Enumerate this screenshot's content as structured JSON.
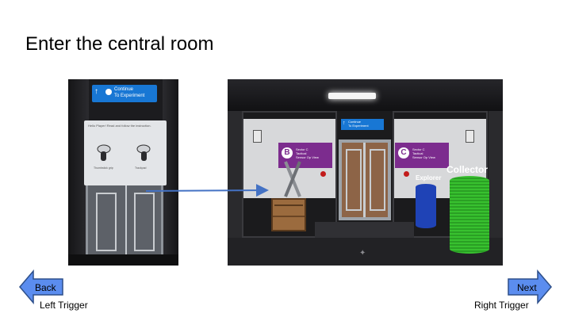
{
  "slide": {
    "title": "Enter the central room"
  },
  "left_screenshot": {
    "banner": {
      "arrow": "↑",
      "line1": "Continue",
      "line2": "To Experiment"
    },
    "instructions": {
      "heading": "Hello Player! Read and follow the instruction.",
      "left_controller_label": "Thumbstick grip",
      "right_controller_label": "Trackpad"
    }
  },
  "right_screenshot": {
    "banner": {
      "arrow": "↑",
      "line1": "Continue",
      "line2": "To Experiment"
    },
    "sign_left": {
      "letter": "B",
      "line1": "Sector C",
      "line2": "Tactical",
      "line3": "Sensor Op View"
    },
    "sign_right": {
      "letter": "C",
      "line1": "Sector C",
      "line2": "Tactical",
      "line3": "Sensor Op View"
    },
    "explorer_label": "Explorer",
    "collector_label": "Collector",
    "colors": {
      "explorer_bin": "#1f43b6",
      "collector_bin": "#38c12f",
      "sign": "#7c2c8e",
      "banner": "#1877d4"
    }
  },
  "navigation": {
    "back": {
      "label": "Back",
      "hint": "Left Trigger"
    },
    "next": {
      "label": "Next",
      "hint": "Right Trigger"
    },
    "button_color": "#5b8def"
  },
  "connector": {
    "color": "#4472c4"
  }
}
